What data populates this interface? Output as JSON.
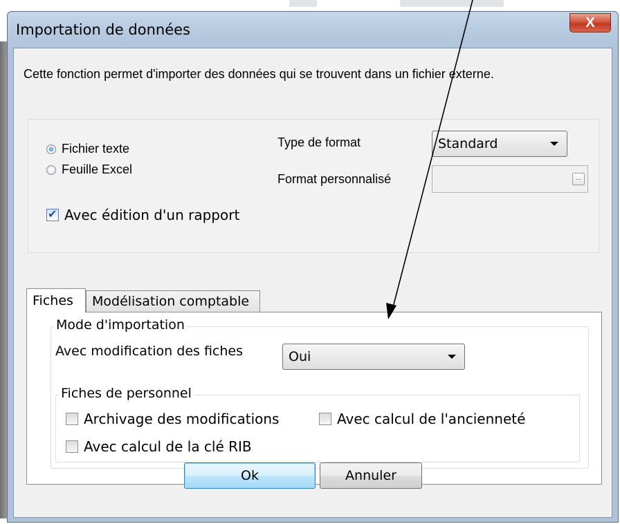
{
  "window": {
    "title": "Importation de données",
    "close_glyph": "X"
  },
  "description": "Cette fonction permet d'importer des données qui se trouvent dans un fichier externe.",
  "source": {
    "options": [
      {
        "label": "Fichier texte",
        "selected": true
      },
      {
        "label": "Feuille Excel",
        "selected": false
      }
    ],
    "report_checkbox": {
      "label": "Avec édition d'un rapport",
      "checked": true
    }
  },
  "format": {
    "type_label": "Type de format",
    "type_value": "Standard",
    "custom_label": "Format personnalisé",
    "custom_value": "",
    "browse_glyph": "..."
  },
  "tabs": [
    {
      "label": "Fiches",
      "active": true
    },
    {
      "label": "Modélisation comptable",
      "active": false
    }
  ],
  "import_mode": {
    "group_title": "Mode d'importation",
    "modify_label": "Avec modification des fiches",
    "modify_value": "Oui",
    "personnel": {
      "group_title": "Fiches de personnel",
      "archive": {
        "label": "Archivage des modifications",
        "checked": false
      },
      "seniority": {
        "label": "Avec calcul de l'ancienneté",
        "checked": false
      },
      "rib": {
        "label": "Avec calcul de la clé RIB",
        "checked": false
      }
    }
  },
  "buttons": {
    "ok": "Ok",
    "cancel": "Annuler"
  },
  "colors": {
    "frame": "#b5c9df",
    "close": "#c9452c",
    "default_button": "#bee6fd"
  }
}
